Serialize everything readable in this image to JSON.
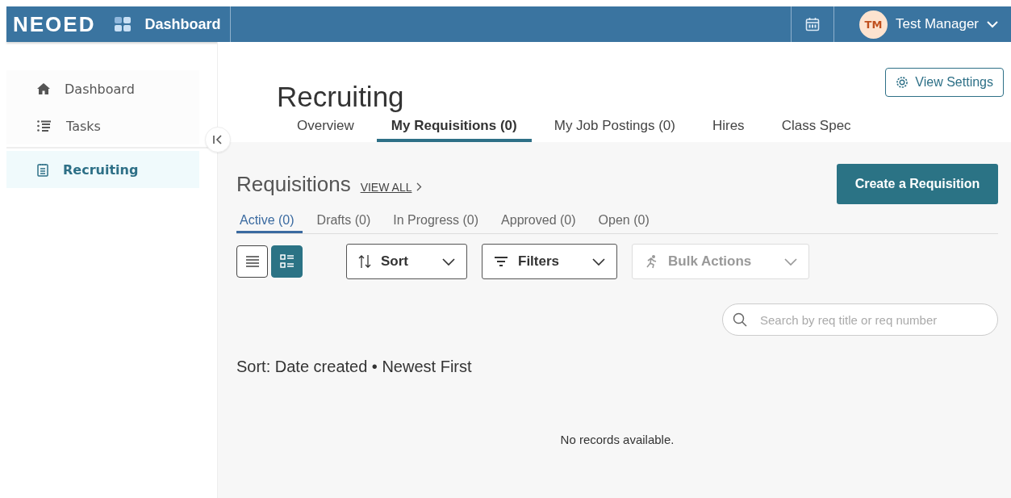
{
  "header": {
    "logo": "NEOED",
    "app_name": "Dashboard",
    "user": {
      "initials": "TM",
      "name": "Test Manager"
    }
  },
  "sidebar": {
    "items": [
      {
        "label": "Dashboard",
        "kind": "home",
        "selected": false
      },
      {
        "label": "Tasks",
        "kind": "tasks",
        "selected": false
      },
      {
        "label": "Recruiting",
        "kind": "clipboard",
        "selected": true
      }
    ]
  },
  "page": {
    "title": "Recruiting",
    "settings_button": "View Settings",
    "tabs": [
      {
        "label": "Overview",
        "selected": false
      },
      {
        "label": "My Requisitions (0)",
        "selected": true
      },
      {
        "label": "My Job Postings (0)",
        "selected": false
      },
      {
        "label": "Hires",
        "selected": false
      },
      {
        "label": "Class Spec",
        "selected": false
      }
    ]
  },
  "requisitions": {
    "heading": "Requisitions",
    "view_all": "VIEW ALL",
    "create_button": "Create a Requisition",
    "tabs": [
      {
        "label": "Active (0)",
        "selected": true
      },
      {
        "label": "Drafts (0)",
        "selected": false
      },
      {
        "label": "In Progress (0)",
        "selected": false
      },
      {
        "label": "Approved (0)",
        "selected": false
      },
      {
        "label": "Open (0)",
        "selected": false
      }
    ],
    "view_toggles": [
      {
        "kind": "list",
        "selected": false
      },
      {
        "kind": "cards",
        "selected": true
      }
    ],
    "dropdowns": [
      {
        "kind": "sort",
        "label": "Sort",
        "disabled": false
      },
      {
        "kind": "filter",
        "label": "Filters",
        "disabled": false
      },
      {
        "kind": "bulk",
        "label": "Bulk Actions",
        "disabled": true
      }
    ],
    "search": {
      "placeholder": "Search by req title or req number"
    },
    "sort_info": "Sort: Date created • Newest First",
    "empty_message": "No records available."
  }
}
